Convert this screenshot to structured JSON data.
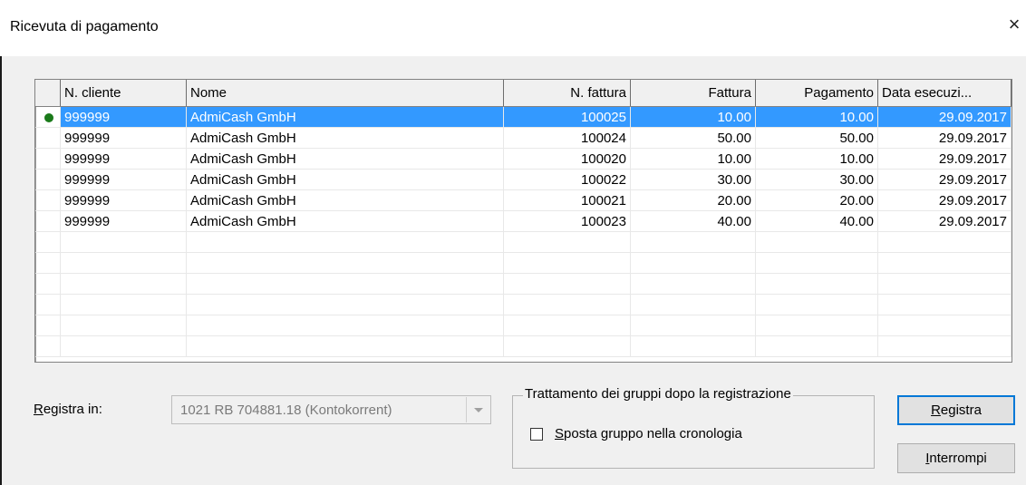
{
  "window": {
    "title": "Ricevuta di pagamento",
    "close_label": "×"
  },
  "table": {
    "columns": [
      "N. cliente",
      "Nome",
      "N. fattura",
      "Fattura",
      "Pagamento",
      "Data esecuzi..."
    ],
    "rows": [
      [
        "999999",
        "AdmiCash GmbH",
        "100025",
        "10.00",
        "10.00",
        "29.09.2017"
      ],
      [
        "999999",
        "AdmiCash GmbH",
        "100024",
        "50.00",
        "50.00",
        "29.09.2017"
      ],
      [
        "999999",
        "AdmiCash GmbH",
        "100020",
        "10.00",
        "10.00",
        "29.09.2017"
      ],
      [
        "999999",
        "AdmiCash GmbH",
        "100022",
        "30.00",
        "30.00",
        "29.09.2017"
      ],
      [
        "999999",
        "AdmiCash GmbH",
        "100021",
        "20.00",
        "20.00",
        "29.09.2017"
      ],
      [
        "999999",
        "AdmiCash GmbH",
        "100023",
        "40.00",
        "40.00",
        "29.09.2017"
      ]
    ],
    "selected_row": 0,
    "indicator_color": "#1a7a1a",
    "selection_color": "#3399ff"
  },
  "register": {
    "label_mnemonic": "R",
    "label_rest": "egistra in:",
    "account_value": "1021 RB 704881.18 (Kontokorrent)"
  },
  "group_options": {
    "legend": "Trattamento dei gruppi dopo la registrazione",
    "checkbox_mnemonic": "S",
    "checkbox_rest": "posta gruppo nella cronologia",
    "checked": false
  },
  "buttons": {
    "register_mnemonic": "R",
    "register_rest": "egistra",
    "cancel_mnemonic": "I",
    "cancel_rest": "nterrompi"
  }
}
